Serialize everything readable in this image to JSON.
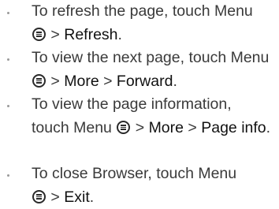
{
  "instructions": [
    {
      "before": "To refresh the page, touch Menu",
      "after": " > ",
      "path": [
        "Refresh"
      ],
      "end": "."
    },
    {
      "before": "To view the next page, touch Menu",
      "after": " > ",
      "path": [
        "More",
        "Forward"
      ],
      "end": "."
    },
    {
      "before": "To view the page information, touch Menu",
      "after": " > ",
      "path": [
        "More",
        "Page info"
      ],
      "end": "."
    },
    {
      "before": "To close Browser, touch Menu",
      "after": " > ",
      "path": [
        "Exit"
      ],
      "end": "."
    }
  ],
  "separator": " > ",
  "icon": "menu-icon"
}
